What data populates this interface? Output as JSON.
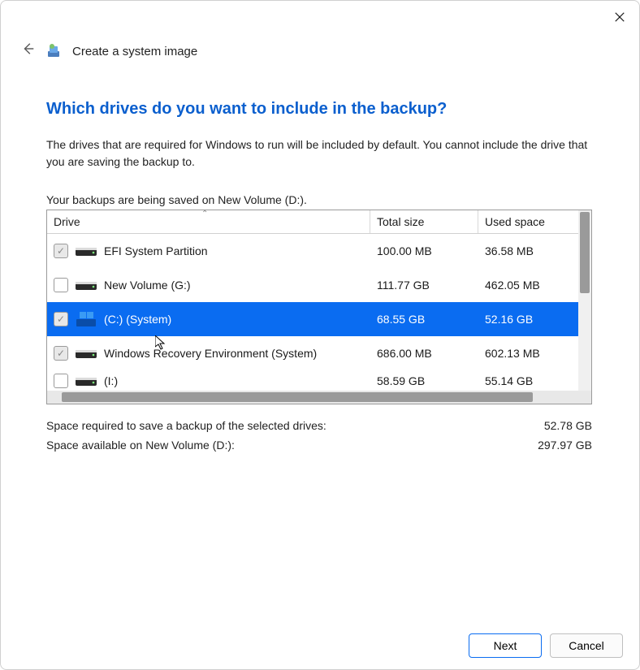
{
  "window": {
    "title": "Create a system image"
  },
  "heading": "Which drives do you want to include in the backup?",
  "description": "The drives that are required for Windows to run will be included by default. You cannot include the drive that you are saving the backup to.",
  "saved_on": "Your backups are being saved on New Volume (D:).",
  "columns": {
    "drive": "Drive",
    "total": "Total size",
    "used": "Used space"
  },
  "rows": [
    {
      "name": "EFI System Partition",
      "total": "100.00 MB",
      "used": "36.58 MB",
      "locked": true,
      "selected": false,
      "icon": "hdd"
    },
    {
      "name": "New Volume (G:)",
      "total": "111.77 GB",
      "used": "462.05 MB",
      "locked": false,
      "selected": false,
      "icon": "hdd"
    },
    {
      "name": "(C:) (System)",
      "total": "68.55 GB",
      "used": "52.16 GB",
      "locked": true,
      "selected": true,
      "icon": "win"
    },
    {
      "name": "Windows Recovery Environment (System)",
      "total": "686.00 MB",
      "used": "602.13 MB",
      "locked": true,
      "selected": false,
      "icon": "hdd"
    },
    {
      "name": "(I:)",
      "total": "58.59 GB",
      "used": "55.14 GB",
      "locked": false,
      "selected": false,
      "icon": "hdd"
    }
  ],
  "summary": {
    "required_label": "Space required to save a backup of the selected drives:",
    "required_value": "52.78 GB",
    "available_label": "Space available on New Volume (D:):",
    "available_value": "297.97 GB"
  },
  "buttons": {
    "next": "Next",
    "cancel": "Cancel"
  }
}
